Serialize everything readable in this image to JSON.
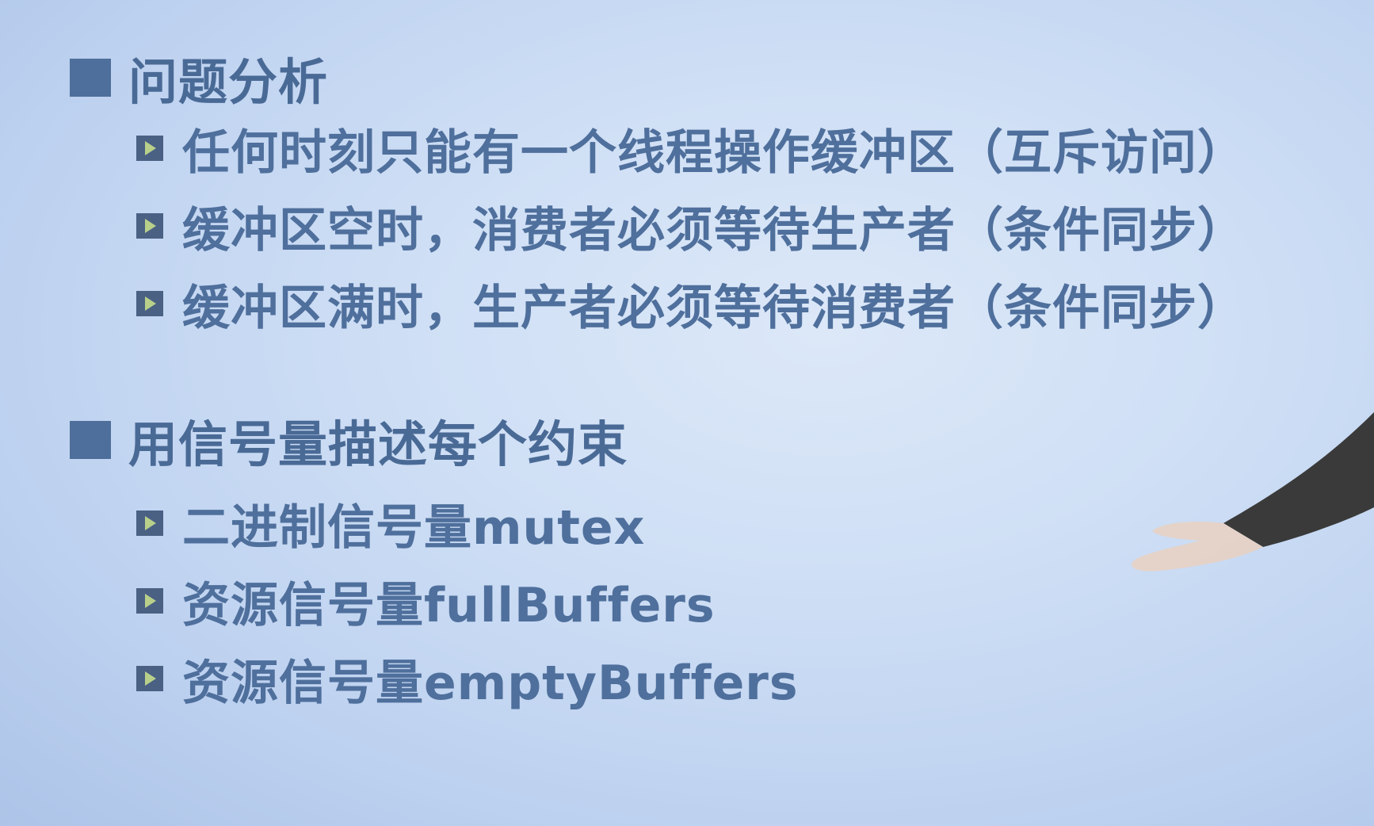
{
  "sections": [
    {
      "heading": "问题分析",
      "items": [
        "任何时刻只能有一个线程操作缓冲区（互斥访问）",
        "缓冲区空时，消费者必须等待生产者（条件同步）",
        "缓冲区满时，生产者必须等待消费者（条件同步）"
      ]
    },
    {
      "heading": "用信号量描述每个约束",
      "items": [
        "二进制信号量mutex",
        "资源信号量fullBuffers",
        "资源信号量emptyBuffers"
      ]
    }
  ],
  "colors": {
    "background": "#cfdff5",
    "heading_text": "#4a6a96",
    "item_text": "#4f6f9c",
    "square_bullet": "#4e6f9b",
    "triangle_bullet_box": "#4a6184",
    "triangle_bullet_arrow": "#b8d08a"
  }
}
